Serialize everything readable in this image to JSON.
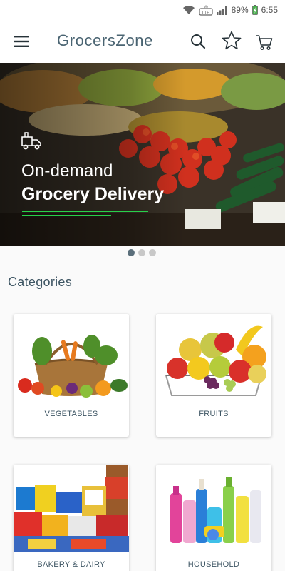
{
  "status_bar": {
    "battery": "89%",
    "time": "6:55",
    "volte_label": "VoLTE"
  },
  "app_bar": {
    "title": "GrocersZone"
  },
  "banner": {
    "line1": "On-demand",
    "line2": "Grocery Delivery",
    "dots_total": 3,
    "dots_active_index": 0
  },
  "categories": {
    "title": "Categories",
    "items": [
      {
        "label": "VEGETABLES"
      },
      {
        "label": "FRUITS"
      },
      {
        "label": "BAKERY & DAIRY"
      },
      {
        "label": "HOUSEHOLD"
      }
    ]
  },
  "colors": {
    "primary_text": "#3d5563",
    "accent_green": "#28d04a",
    "dot_active": "#5b6f7b",
    "dot_inactive": "#c8c8c8"
  }
}
